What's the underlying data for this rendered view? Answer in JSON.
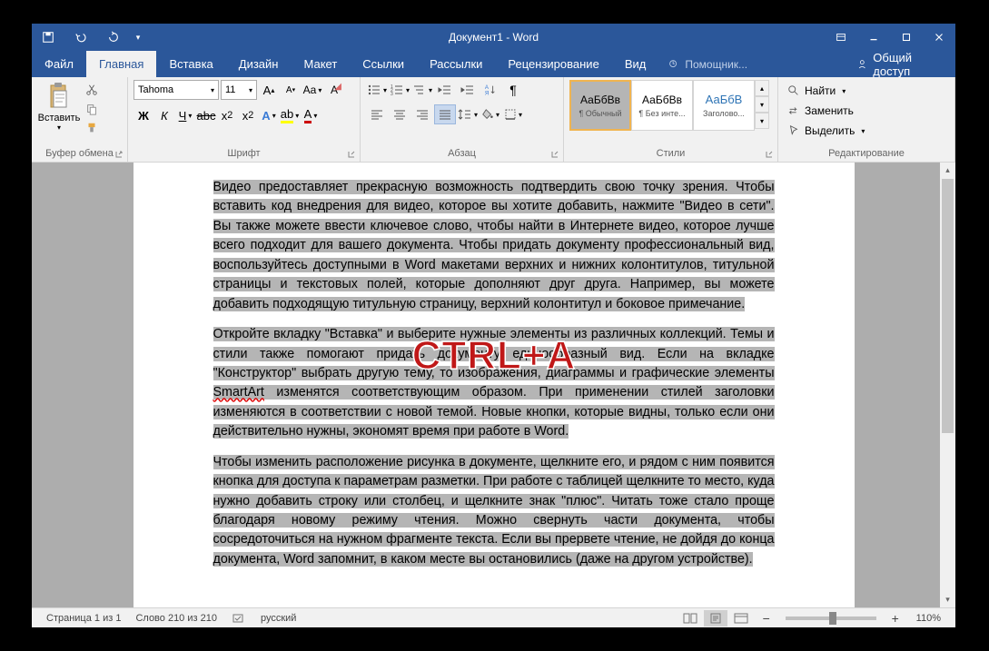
{
  "titlebar": {
    "title": "Документ1 - Word"
  },
  "menu": {
    "file": "Файл",
    "home": "Главная",
    "insert": "Вставка",
    "design": "Дизайн",
    "layout": "Макет",
    "references": "Ссылки",
    "mailings": "Рассылки",
    "review": "Рецензирование",
    "view": "Вид",
    "tellme": "Помощник...",
    "share": "Общий доступ"
  },
  "ribbon": {
    "clipboard": {
      "label": "Буфер обмена",
      "paste": "Вставить"
    },
    "font": {
      "label": "Шрифт",
      "name": "Tahoma",
      "size": "11"
    },
    "paragraph": {
      "label": "Абзац"
    },
    "styles": {
      "label": "Стили",
      "items": [
        {
          "sample": "АаБбВв",
          "name": "¶ Обычный"
        },
        {
          "sample": "АаБбВв",
          "name": "¶ Без инте..."
        },
        {
          "sample": "АаБбВ",
          "name": "Заголово..."
        }
      ]
    },
    "editing": {
      "label": "Редактирование",
      "find": "Найти",
      "replace": "Заменить",
      "select": "Выделить"
    }
  },
  "document": {
    "p1": "Видео предоставляет прекрасную возможность подтвердить свою точку зрения. Чтобы вставить код внедрения для видео, которое вы хотите добавить, нажмите \"Видео в сети\". Вы также можете ввести ключевое слово, чтобы найти в Интернете видео, которое лучше всего подходит для вашего документа. Чтобы придать документу профессиональный вид, воспользуйтесь доступными в Word макетами верхних и нижних колонтитулов, титульной страницы и текстовых полей, которые дополняют друг друга. Например, вы можете добавить подходящую титульную страницу, верхний колонтитул и боковое примечание.",
    "p2a": "Откройте вкладку \"Вставка\" и выберите нужные элементы из различных коллекций. Темы и стили также помогают придать документу единообразный вид. Если на вкладке \"Конструктор\" выбрать другую тему, то изображения, диаграммы и графические элементы ",
    "p2_smartart": "SmartArt",
    "p2b": " изменятся соответствующим образом. При применении стилей заголовки изменяются в соответствии с новой темой. Новые кнопки, которые видны, только если они действительно нужны, экономят время при работе в Word.",
    "p3": "Чтобы изменить расположение рисунка в документе, щелкните его, и рядом с ним появится кнопка для доступа к параметрам разметки. При работе с таблицей щелкните то место, куда нужно добавить строку или столбец, и щелкните знак \"плюс\". Читать тоже стало проще благодаря новому режиму чтения. Можно свернуть части документа, чтобы сосредоточиться на нужном фрагменте текста. Если вы прервете чтение, не дойдя до конца документа, Word запомнит, в каком месте вы остановились (даже на другом устройстве)."
  },
  "overlay": "CTRL+A",
  "status": {
    "page": "Страница 1 из 1",
    "words": "Слово 210 из 210",
    "lang": "русский",
    "zoom": "110%"
  }
}
